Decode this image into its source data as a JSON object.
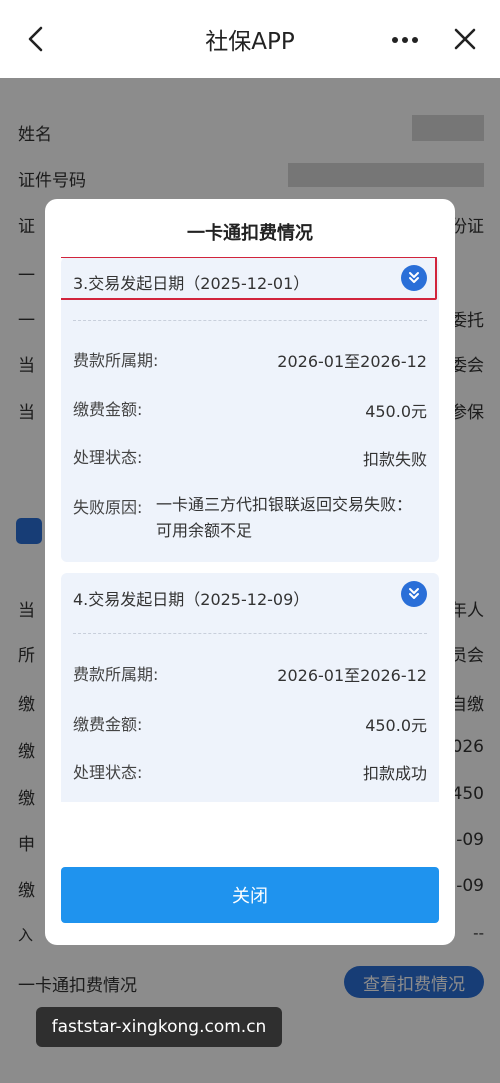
{
  "app_bar": {
    "title": "社保APP",
    "back_icon": "chevron-left-icon",
    "more_icon": "more-dots-icon",
    "close_icon": "close-icon"
  },
  "background": {
    "rows": [
      {
        "label": "姓名",
        "value": ""
      },
      {
        "label": "证件号码",
        "value": ""
      },
      {
        "label": "证",
        "value": "份证"
      },
      {
        "label": "一",
        "value": ""
      },
      {
        "label": "一",
        "value": "委托"
      },
      {
        "label": "当",
        "value": "委会"
      },
      {
        "label": "当",
        "value": "参保"
      },
      {
        "label": "当",
        "value": "年人"
      },
      {
        "label": "所",
        "value": "员会"
      },
      {
        "label": "缴",
        "value": "自缴"
      },
      {
        "label": "缴",
        "value": "026"
      },
      {
        "label": "缴",
        "value": "450"
      },
      {
        "label": "申",
        "value": "2-09"
      },
      {
        "label": "缴",
        "value": "2-09"
      },
      {
        "label": "入",
        "value": "--"
      }
    ],
    "footer_label": "一卡通扣费情况",
    "footer_button": "查看扣费情况"
  },
  "modal": {
    "title": "一卡通扣费情况",
    "records": [
      {
        "header": "3.交易发起日期（2025-12-01）",
        "fields": [
          {
            "label": "费款所属期:",
            "value": "2026-01至2026-12"
          },
          {
            "label": "缴费金额:",
            "value": "450.0元"
          },
          {
            "label": "处理状态:",
            "value": "扣款失败"
          }
        ],
        "reason_label": "失败原因:",
        "reason_value": "一卡通三方代扣银联返回交易失败：可用余额不足"
      },
      {
        "header": "4.交易发起日期（2025-12-09）",
        "fields": [
          {
            "label": "费款所属期:",
            "value": "2026-01至2026-12"
          },
          {
            "label": "缴费金额:",
            "value": "450.0元"
          },
          {
            "label": "处理状态:",
            "value": "扣款成功"
          }
        ]
      }
    ],
    "close_label": "关闭"
  },
  "watermark": "faststar-xingkong.com.cn",
  "colors": {
    "accent": "#2a6fd8",
    "button": "#1f93ee",
    "highlight": "#d1243c",
    "card_bg": "#eef3fb"
  }
}
